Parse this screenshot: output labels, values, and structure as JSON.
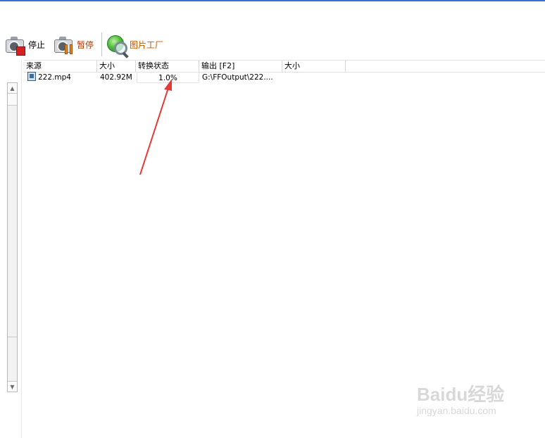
{
  "toolbar": {
    "stop_label": "停止",
    "pause_label": "暂停",
    "picture_factory_label": "图片工厂",
    "stop_icon": "camera-stop-icon",
    "pause_icon": "camera-pause-icon",
    "picture_icon": "globe-magnifier-icon"
  },
  "list": {
    "columns": [
      "来源",
      "大小",
      "转换状态",
      "输出 [F2]",
      "大小"
    ],
    "rows": [
      {
        "source": "222.mp4",
        "size": "402.92M",
        "status": "1.0%",
        "output": "G:\\FFOutput\\222....",
        "output_size": ""
      }
    ]
  },
  "progress": {
    "value": 0.01
  },
  "watermark": {
    "main": "Baidu经验",
    "sub": "jingyan.baidu.com"
  },
  "colors": {
    "accent_line": "#3b6fd6",
    "pause_label": "#b03a00",
    "picture_label": "#c05a00",
    "annotation_arrow": "#e53935"
  }
}
